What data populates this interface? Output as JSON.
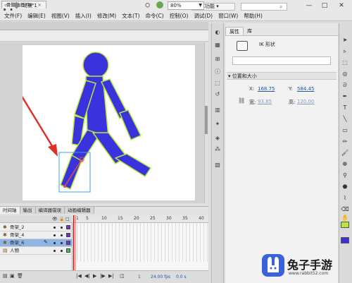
{
  "app": {
    "logo": "Fl",
    "workspace": "基本功能 ▾",
    "window_buttons": [
      "—",
      "□",
      "✕"
    ]
  },
  "menu": [
    "文件(F)",
    "编辑(E)",
    "视图(V)",
    "插入(I)",
    "修改(M)",
    "文本(T)",
    "命令(C)",
    "控制(O)",
    "调试(D)",
    "窗口(W)",
    "帮助(H)"
  ],
  "document": {
    "tab_label": "骨骼动画.fla*",
    "tab_close": "×",
    "scene": "场景 1",
    "zoom": "80%"
  },
  "stage": {
    "figure_fill": "#3a33dd",
    "figure_stroke": "#b6e83a",
    "arrow_color": "#e0302a",
    "selection_color": "#3aa0e0"
  },
  "timeline": {
    "tabs": [
      "时间轴",
      "输出",
      "编译器错误",
      "动画编辑器"
    ],
    "frame_numbers": [
      "1",
      "5",
      "10",
      "15",
      "20",
      "25",
      "30",
      "35",
      "40"
    ],
    "layers": [
      {
        "label": "骨架_2",
        "color": "#7a2fd0",
        "selected": false
      },
      {
        "label": "骨架_4",
        "color": "#7a2fd0",
        "selected": false
      },
      {
        "label": "骨架_6",
        "color": "#7a2fd0",
        "selected": true
      },
      {
        "label": "人物",
        "color": "#3cc23c",
        "selected": false
      }
    ],
    "current_frame": "1",
    "fps": "24.00 fps",
    "time": "0.0 s"
  },
  "properties": {
    "tabs": [
      "属性",
      "库"
    ],
    "symbol_type": "IK 形状",
    "section_title": "位置和大小",
    "x_label": "X:",
    "x_value": "168.75",
    "y_label": "Y:",
    "y_value": "584.45",
    "w_label": "宽:",
    "w_value": "93.85",
    "h_label": "高:",
    "h_value": "120.00"
  },
  "watermark": {
    "brand": "兔子手游",
    "url": "www.rabbit52.com"
  }
}
